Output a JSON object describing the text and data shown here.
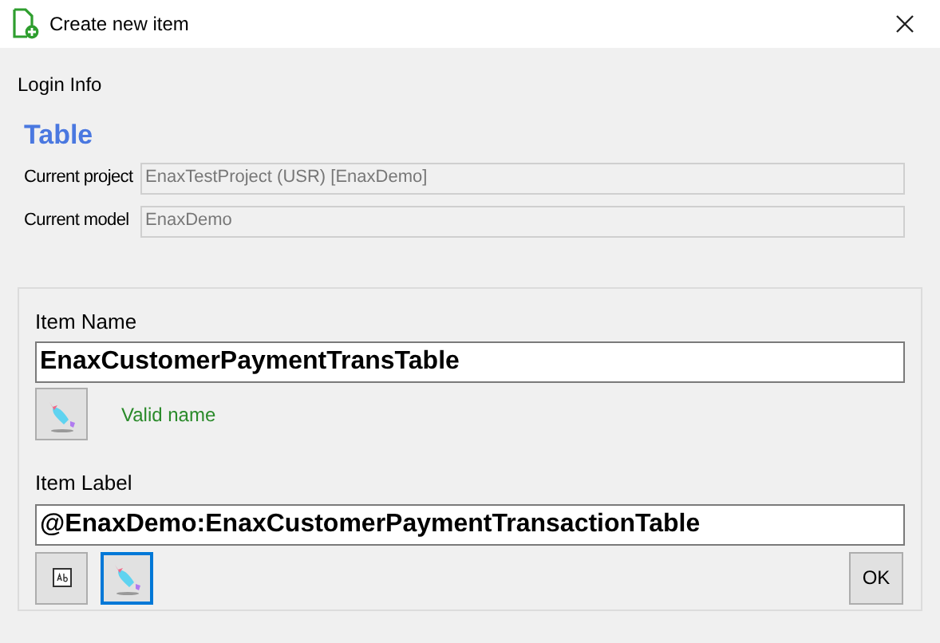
{
  "window": {
    "title": "Create new item"
  },
  "section_title": "Login Info",
  "heading": "Table",
  "info_fields": [
    {
      "label": "Current project",
      "value": "EnaxTestProject (USR) [EnaxDemo]"
    },
    {
      "label": "Current model",
      "value": "EnaxDemo"
    }
  ],
  "item_name": {
    "label": "Item Name",
    "value": "EnaxCustomerPaymentTransTable",
    "validation": "Valid name"
  },
  "item_label": {
    "label": "Item Label",
    "value": "@EnaxDemo:EnaxCustomerPaymentTransactionTable"
  },
  "label_buttons": [
    {
      "kind": "text",
      "focused": false
    },
    {
      "kind": "magic",
      "focused": true
    }
  ],
  "ok_button": "OK"
}
